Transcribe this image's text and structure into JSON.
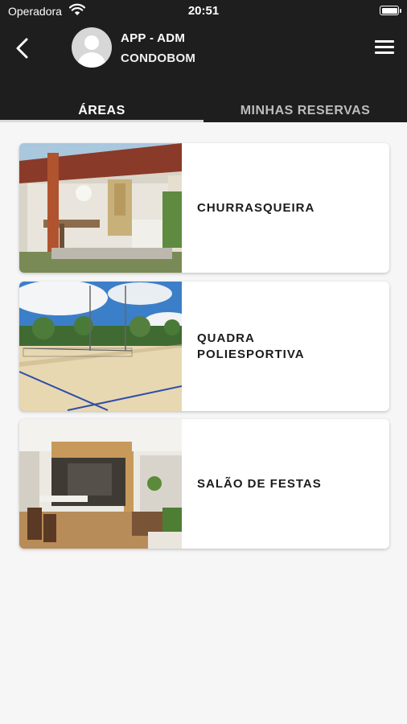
{
  "status_bar": {
    "carrier": "Operadora",
    "time": "20:51",
    "wifi_icon": "wifi-icon",
    "battery_icon": "battery-icon"
  },
  "header": {
    "title": "APP - ADM",
    "subtitle": "CONDOBOM",
    "back_icon": "chevron-left-icon",
    "menu_icon": "hamburger-menu-icon",
    "avatar_icon": "user-avatar-icon",
    "background": "#1e1e1e"
  },
  "tabs": [
    {
      "label": "ÁREAS",
      "active": true
    },
    {
      "label": "MINHAS RESERVAS",
      "active": false
    }
  ],
  "areas": [
    {
      "name": "CHURRASQUEIRA",
      "image": "barbecue-area-photo"
    },
    {
      "name": "QUADRA\nPOLIESPORTIVA",
      "image": "sports-court-photo"
    },
    {
      "name": "SALÃO DE FESTAS",
      "image": "party-hall-photo"
    }
  ]
}
